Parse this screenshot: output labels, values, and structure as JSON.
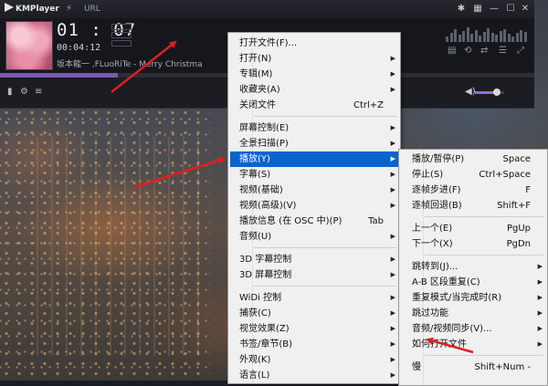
{
  "titlebar": {
    "app_name": "KMPlayer",
    "url_label": "URL",
    "icons": [
      "pin-icon",
      "skin-icon",
      "minimize-icon",
      "maximize-icon",
      "close-icon"
    ]
  },
  "player": {
    "time_main": "01 : 07",
    "time_sub": "00:04:12",
    "now_playing": "坂本龍一 ,FLuoRiTe - Merry Christmas Mr.",
    "seek_progress": 0.22,
    "volume_level": 0.75
  },
  "colors": {
    "highlight": "#0a64ce",
    "menu_bg": "#f0f0f0",
    "accent_purple": "#7a5ab0",
    "arrow_red": "#e01e1e"
  },
  "main_menu": {
    "items": [
      {
        "label": "打开文件(F)...",
        "shortcut": "",
        "submenu": false
      },
      {
        "label": "打开(N)",
        "shortcut": "",
        "submenu": true
      },
      {
        "label": "专辑(M)",
        "shortcut": "",
        "submenu": true
      },
      {
        "label": "收藏夹(A)",
        "shortcut": "",
        "submenu": true
      },
      {
        "label": "关闭文件",
        "shortcut": "Ctrl+Z",
        "submenu": false
      },
      {
        "label": "屏幕控制(E)",
        "shortcut": "",
        "submenu": true
      },
      {
        "label": "全景扫描(P)",
        "shortcut": "",
        "submenu": true
      },
      {
        "label": "播放(Y)",
        "shortcut": "",
        "submenu": true
      },
      {
        "label": "字幕(S)",
        "shortcut": "",
        "submenu": true
      },
      {
        "label": "视频(基础)",
        "shortcut": "",
        "submenu": true
      },
      {
        "label": "视频(高级)(V)",
        "shortcut": "",
        "submenu": true
      },
      {
        "label": "播放信息 (在 OSC 中)(P)",
        "shortcut": "Tab",
        "submenu": false
      },
      {
        "label": "音频(U)",
        "shortcut": "",
        "submenu": true
      },
      {
        "label": "3D 字幕控制",
        "shortcut": "",
        "submenu": true
      },
      {
        "label": "3D 屏幕控制",
        "shortcut": "",
        "submenu": true
      },
      {
        "label": "WiDi 控制",
        "shortcut": "",
        "submenu": true
      },
      {
        "label": "捕获(C)",
        "shortcut": "",
        "submenu": true
      },
      {
        "label": "视觉效果(Z)",
        "shortcut": "",
        "submenu": true
      },
      {
        "label": "书签/章节(B)",
        "shortcut": "",
        "submenu": true
      },
      {
        "label": "外观(K)",
        "shortcut": "",
        "submenu": true
      },
      {
        "label": "语言(L)",
        "shortcut": "",
        "submenu": true
      }
    ]
  },
  "play_submenu": {
    "items": [
      {
        "label": "播放/暂停(P)",
        "shortcut": "Space",
        "submenu": false
      },
      {
        "label": "停止(S)",
        "shortcut": "Ctrl+Space",
        "submenu": false
      },
      {
        "label": "逐帧步进(F)",
        "shortcut": "F",
        "submenu": false
      },
      {
        "label": "逐帧回退(B)",
        "shortcut": "Shift+F",
        "submenu": false
      },
      {
        "label": "上一个(E)",
        "shortcut": "PgUp",
        "submenu": false
      },
      {
        "label": "下一个(X)",
        "shortcut": "PgDn",
        "submenu": false
      },
      {
        "label": "跳转到(J)...",
        "shortcut": "",
        "submenu": true
      },
      {
        "label": "A-B 区段重复(C)",
        "shortcut": "",
        "submenu": true
      },
      {
        "label": "重复模式/当完成时(R)",
        "shortcut": "",
        "submenu": true
      },
      {
        "label": "跳过功能",
        "shortcut": "",
        "submenu": true
      },
      {
        "label": "音频/视频同步(V)...",
        "shortcut": "",
        "submenu": true
      },
      {
        "label": "如何打开文件",
        "shortcut": "",
        "submenu": true
      },
      {
        "label": "慢",
        "shortcut": "Shift+Num -",
        "submenu": false
      }
    ]
  }
}
